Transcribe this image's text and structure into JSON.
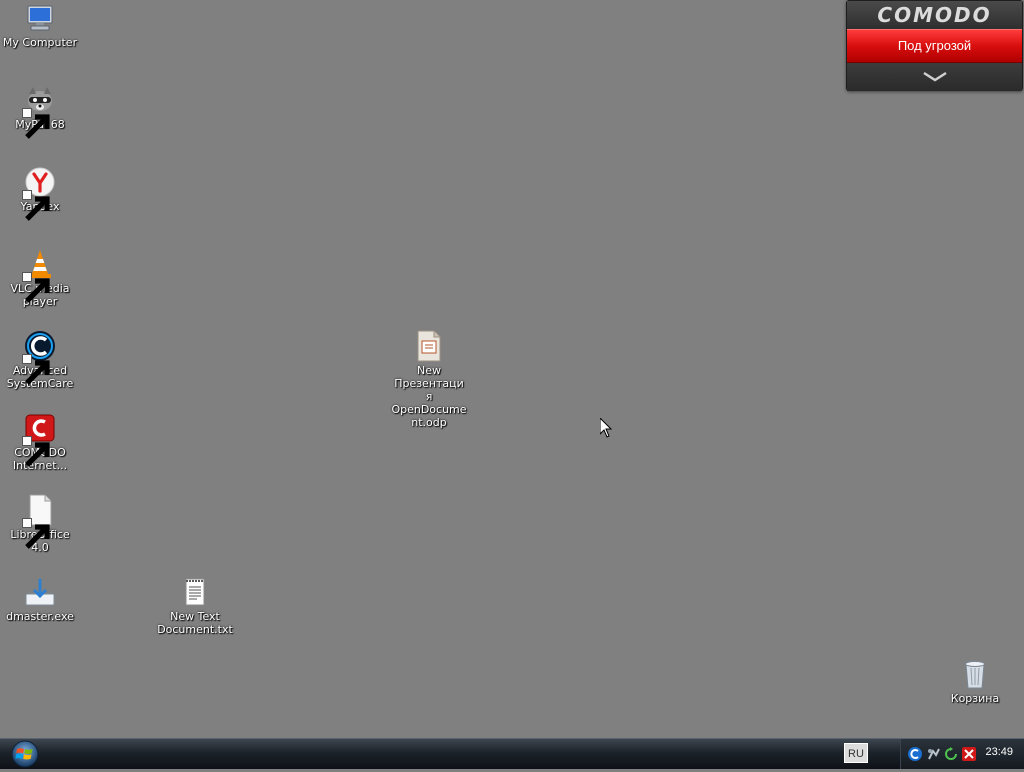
{
  "desktop": {
    "icons": [
      {
        "label": "My Computer"
      },
      {
        "label": "MyPal 68"
      },
      {
        "label": "Yandex"
      },
      {
        "label": "VLC media player"
      },
      {
        "label": "Advanced SystemCare"
      },
      {
        "label": "COMODO Internet..."
      },
      {
        "label": "LibreOffice 4.0"
      },
      {
        "label": "dmaster.exe"
      },
      {
        "label": "New Text Document.txt"
      },
      {
        "label": "New Презентация OpenDocument.odp"
      },
      {
        "label": "Корзина"
      }
    ]
  },
  "comodo_widget": {
    "brand": "COMODO",
    "status": "Под угрозой",
    "status_color": "#e01010"
  },
  "taskbar": {
    "language": "RU",
    "clock": "23:49",
    "tray_icons": [
      "comodo-icon",
      "network-icon",
      "refresh-icon",
      "close-red-icon"
    ]
  }
}
